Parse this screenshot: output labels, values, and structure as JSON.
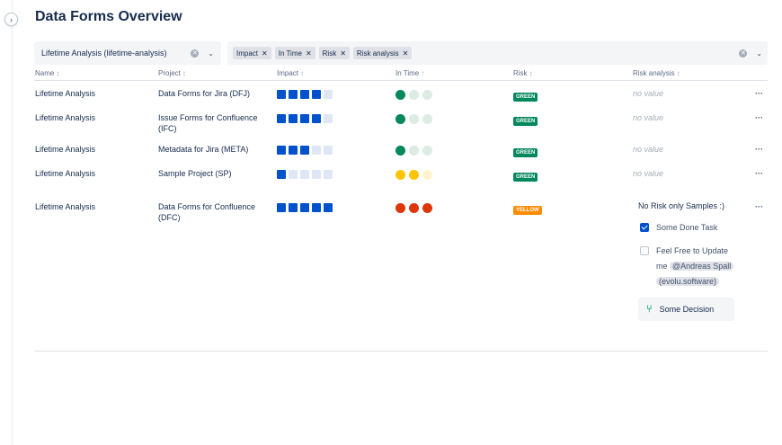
{
  "page": {
    "title": "Data Forms Overview",
    "expand_icon": "chevron-right-icon"
  },
  "filter": {
    "select_value": "Lifetime Analysis (lifetime-analysis)",
    "chips": [
      {
        "label": "Impact"
      },
      {
        "label": "In Time"
      },
      {
        "label": "Risk"
      },
      {
        "label": "Risk analysis"
      }
    ]
  },
  "table": {
    "columns": [
      {
        "label": "Name",
        "sort": "↕"
      },
      {
        "label": "Project",
        "sort": "↕"
      },
      {
        "label": "Impact",
        "sort": "↕"
      },
      {
        "label": "In Time",
        "sort": "↑"
      },
      {
        "label": "Risk",
        "sort": "↕"
      },
      {
        "label": "Risk analysis",
        "sort": "↕"
      }
    ],
    "rows": [
      {
        "name": "Lifetime Analysis",
        "project": "Data Forms for Jira (DFJ)",
        "impact": 4,
        "in_time": 1,
        "in_time_color": "green",
        "risk": "GREEN",
        "risk_analysis": "no value",
        "more": "···"
      },
      {
        "name": "Lifetime Analysis",
        "project": "Issue Forms for Confluence (IFC)",
        "impact": 4,
        "in_time": 1,
        "in_time_color": "green",
        "risk": "GREEN",
        "risk_analysis": "no value",
        "more": "···"
      },
      {
        "name": "Lifetime Analysis",
        "project": "Metadata for Jira (META)",
        "impact": 3,
        "in_time": 1,
        "in_time_color": "green",
        "risk": "GREEN",
        "risk_analysis": "no value",
        "more": "···"
      },
      {
        "name": "Lifetime Analysis",
        "project": "Sample Project (SP)",
        "impact": 1,
        "in_time": 2,
        "in_time_color": "yellow",
        "risk": "GREEN",
        "risk_analysis": "no value",
        "more": "···"
      },
      {
        "name": "Lifetime Analysis",
        "project": "Data Forms for Confluence (DFC)",
        "impact": 5,
        "in_time": 3,
        "in_time_color": "red",
        "risk": "YELLOW",
        "more": "···",
        "risk_analysis_text": "No Risk only Samples :)",
        "tasks": [
          {
            "text": "Some Done Task",
            "done": true
          },
          {
            "text_pre": "Feel Free to Update",
            "text_me": "me",
            "mention": "@Andreas Spall",
            "mention_2": "(evolu.software)",
            "done": false
          }
        ],
        "decision": "Some Decision"
      }
    ]
  },
  "colors": {
    "impact_on": "#0052cc",
    "impact_off": "#dfe7f7",
    "green_on": "#00875a",
    "green_off": "#dcece3",
    "yellow_on": "#ffc400",
    "yellow_off": "#fff4cc",
    "red_on": "#de350b",
    "lozenge_green": "#00875a",
    "lozenge_yellow": "#ff8b00"
  }
}
